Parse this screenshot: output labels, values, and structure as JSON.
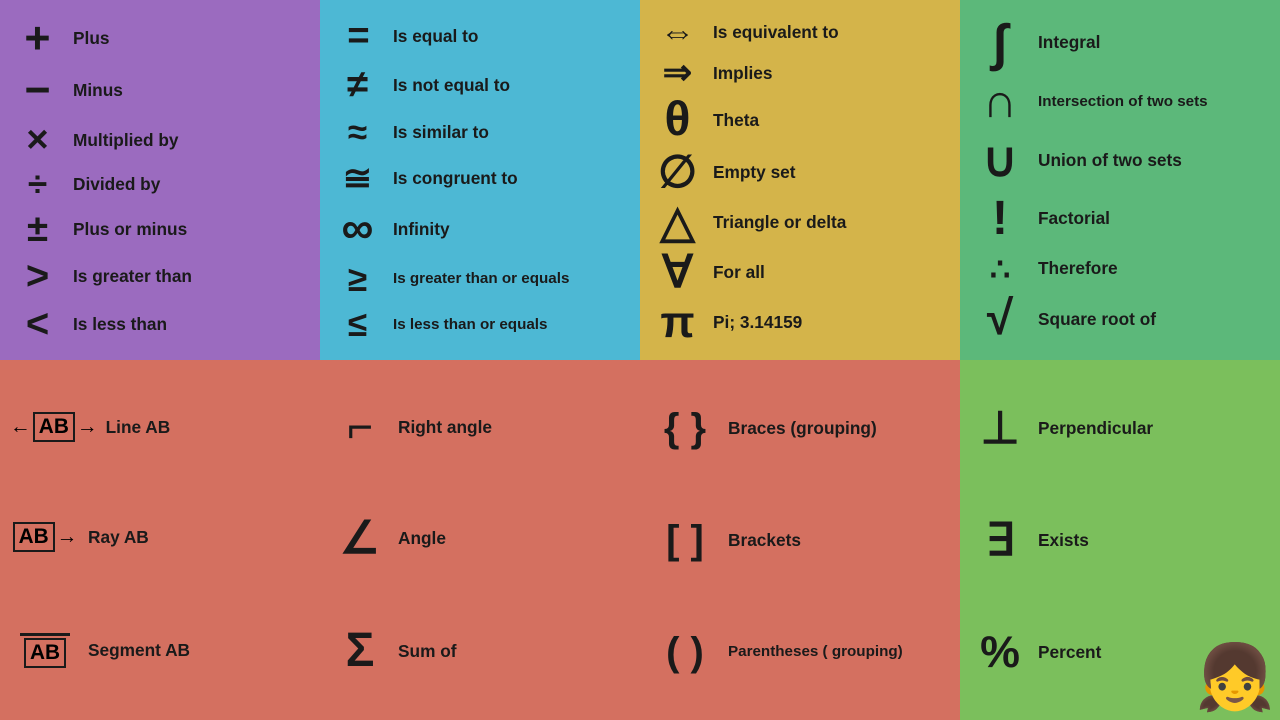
{
  "cells": {
    "c1": {
      "bg": "purple",
      "items": [
        {
          "symbol": "+",
          "label": "Plus"
        },
        {
          "symbol": "−",
          "label": "Minus"
        },
        {
          "symbol": "×",
          "label": "Multiplied by"
        },
        {
          "symbol": "÷",
          "label": "Divided by"
        },
        {
          "symbol": "±",
          "label": "Plus or minus"
        },
        {
          "symbol": ">",
          "label": "Is greater than"
        },
        {
          "symbol": "<",
          "label": "Is less than"
        }
      ]
    },
    "c2": {
      "bg": "blue",
      "items": [
        {
          "symbol": "=",
          "label": "Is equal to"
        },
        {
          "symbol": "≠",
          "label": "Is not equal to"
        },
        {
          "symbol": "≈",
          "label": "Is similar to"
        },
        {
          "symbol": "≅",
          "label": "Is congruent to"
        },
        {
          "symbol": "∞",
          "label": "Infinity"
        },
        {
          "symbol": "≥",
          "label": "Is greater than or equals"
        },
        {
          "symbol": "≤",
          "label": "Is less than or equals"
        }
      ]
    },
    "c3": {
      "bg": "gold",
      "items": [
        {
          "symbol": "⇔",
          "label": "Is equivalent to"
        },
        {
          "symbol": "⇒",
          "label": "Implies"
        },
        {
          "symbol": "θ",
          "label": "Theta"
        },
        {
          "symbol": "∅",
          "label": "Empty set"
        },
        {
          "symbol": "△",
          "label": "Triangle or delta"
        },
        {
          "symbol": "∀",
          "label": "For all"
        },
        {
          "symbol": "π",
          "label": "Pi; 3.14159"
        }
      ]
    },
    "c4": {
      "bg": "green",
      "items": [
        {
          "symbol": "∫",
          "label": "Integral"
        },
        {
          "symbol": "∩",
          "label": "Intersection of two sets"
        },
        {
          "symbol": "∪",
          "label": "Union of two sets"
        },
        {
          "symbol": "!",
          "label": "Factorial"
        },
        {
          "symbol": "∴",
          "label": "Therefore"
        },
        {
          "symbol": "√",
          "label": "Square root of"
        }
      ]
    },
    "c5": {
      "bg": "salmon",
      "items": [
        {
          "symbol": "AB_line",
          "label": "Line AB"
        },
        {
          "symbol": "AB_ray",
          "label": "Ray AB"
        },
        {
          "symbol": "AB_seg",
          "label": "Segment AB"
        }
      ]
    },
    "c6": {
      "bg": "salmon",
      "items": [
        {
          "symbol": "⌐",
          "label": "Right angle"
        },
        {
          "symbol": "∠",
          "label": "Angle"
        },
        {
          "symbol": "Σ",
          "label": "Sum of"
        }
      ]
    },
    "c7": {
      "bg": "salmon",
      "items": [
        {
          "symbol": "{ }",
          "label": "Braces (grouping)"
        },
        {
          "symbol": "[ ]",
          "label": "Brackets"
        },
        {
          "symbol": "( )",
          "label": "Parentheses ( grouping)"
        }
      ]
    },
    "c8": {
      "bg": "green2",
      "items": [
        {
          "symbol": "⊥",
          "label": "Perpendicular"
        },
        {
          "symbol": "∃",
          "label": "Exists"
        },
        {
          "symbol": "%",
          "label": "Percent"
        }
      ]
    }
  }
}
